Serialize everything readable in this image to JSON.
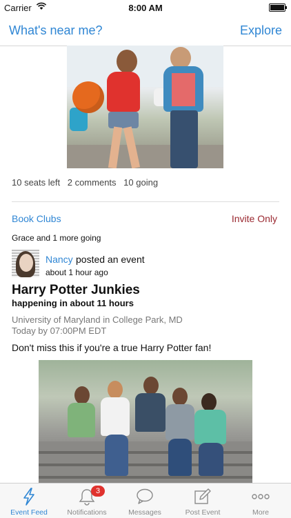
{
  "status_bar": {
    "carrier": "Carrier",
    "time": "8:00 AM"
  },
  "nav": {
    "left": "What's near me?",
    "right": "Explore"
  },
  "post1": {
    "seats": "10 seats left",
    "comments": "2 comments",
    "going": "10 going"
  },
  "post2": {
    "group": "Book Clubs",
    "privacy": "Invite Only",
    "going_summary": "Grace and 1 more going",
    "author": "Nancy",
    "action": "posted an event",
    "time_ago": "about 1 hour ago",
    "title": "Harry Potter Junkies",
    "subtitle": "happening in about 11 hours",
    "location": "University of Maryland in College Park, MD",
    "when": "Today by 07:00PM EDT",
    "description": "Don't miss this if you're a true Harry Potter fan!"
  },
  "tabs": [
    {
      "label": "Event Feed",
      "icon": "lightning-icon",
      "active": true
    },
    {
      "label": "Notifications",
      "icon": "bell-icon",
      "badge": "3"
    },
    {
      "label": "Messages",
      "icon": "speech-bubble-icon"
    },
    {
      "label": "Post Event",
      "icon": "compose-icon"
    },
    {
      "label": "More",
      "icon": "more-dots-icon"
    }
  ],
  "colors": {
    "accent": "#2f86d4",
    "invite": "#9a2830",
    "badge": "#e0322e"
  }
}
